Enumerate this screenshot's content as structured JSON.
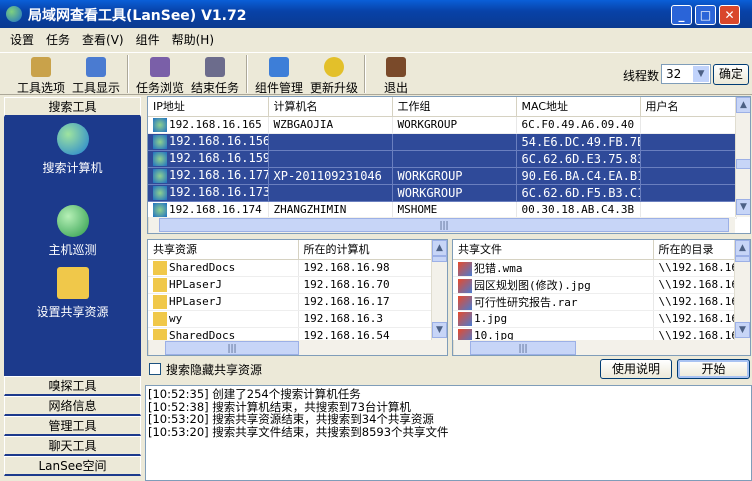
{
  "title": "局域网查看工具(LanSee) V1.72",
  "menu": [
    "设置",
    "任务",
    "查看(V)",
    "组件",
    "帮助(H)"
  ],
  "toolbar": [
    "工具选项",
    "工具显示",
    "任务浏览",
    "结束任务",
    "组件管理",
    "更新升级",
    "退出"
  ],
  "threads": {
    "label": "线程数",
    "value": "32",
    "ok": "确定"
  },
  "sidebar": {
    "header": "搜索工具",
    "items": [
      "搜索计算机",
      "主机巡测",
      "设置共享资源"
    ],
    "sections": [
      "嗅探工具",
      "网络信息",
      "管理工具",
      "聊天工具",
      "LanSee空间"
    ]
  },
  "hosts": {
    "columns": [
      "IP地址",
      "计算机名",
      "工作组",
      "MAC地址",
      "用户名"
    ],
    "rows": [
      {
        "ip": "192.168.16.165",
        "name": "WZBGAOJIA",
        "group": "WORKGROUP",
        "mac": "6C.F0.49.A6.09.40",
        "user": "",
        "selected": false
      },
      {
        "ip": "192.168.16.156",
        "name": "",
        "group": "",
        "mac": "54.E6.DC.49.FB.7B",
        "user": "",
        "selected": true
      },
      {
        "ip": "192.168.16.159",
        "name": "",
        "group": "",
        "mac": "6C.62.6D.E3.75.83",
        "user": "",
        "selected": true
      },
      {
        "ip": "192.168.16.177",
        "name": "XP-201109231046",
        "group": "WORKGROUP",
        "mac": "90.E6.BA.C4.EA.B1",
        "user": "",
        "selected": true
      },
      {
        "ip": "192.168.16.173",
        "name": "",
        "group": "WORKGROUP",
        "mac": "6C.62.6D.F5.B3.C1",
        "user": "",
        "selected": true
      },
      {
        "ip": "192.168.16.174",
        "name": "ZHANGZHIMIN",
        "group": "MSHOME",
        "mac": "00.30.18.AB.C4.3B",
        "user": "",
        "selected": false
      }
    ]
  },
  "shares": {
    "columns": [
      "共享资源",
      "所在的计算机"
    ],
    "rows": [
      [
        "SharedDocs",
        "192.168.16.98"
      ],
      [
        "HPLaserJ",
        "192.168.16.70"
      ],
      [
        "HPLaserJ",
        "192.168.16.17"
      ],
      [
        "wy",
        "192.168.16.3"
      ],
      [
        "SharedDocs",
        "192.168.16.54"
      ]
    ]
  },
  "files": {
    "columns": [
      "共享文件",
      "所在的目录"
    ],
    "rows": [
      [
        "犯错.wma",
        "\\\\192.168.16."
      ],
      [
        "园区规划图(修改).jpg",
        "\\\\192.168.16."
      ],
      [
        "可行性研究报告.rar",
        "\\\\192.168.16."
      ],
      [
        "1.jpg",
        "\\\\192.168.16."
      ],
      [
        "10.jpg",
        "\\\\192.168.16."
      ]
    ]
  },
  "hidden_shares_label": "搜索隐藏共享资源",
  "help_button": "使用说明",
  "start_button": "开始",
  "log": [
    "[10:52:35] 创建了254个搜索计算机任务",
    "[10:52:38] 搜索计算机结束，共搜索到73台计算机",
    "[10:53:20] 搜索共享资源结束，共搜索到34个共享资源",
    "[10:53:20] 搜索共享文件结束，共搜索到8593个共享文件"
  ]
}
